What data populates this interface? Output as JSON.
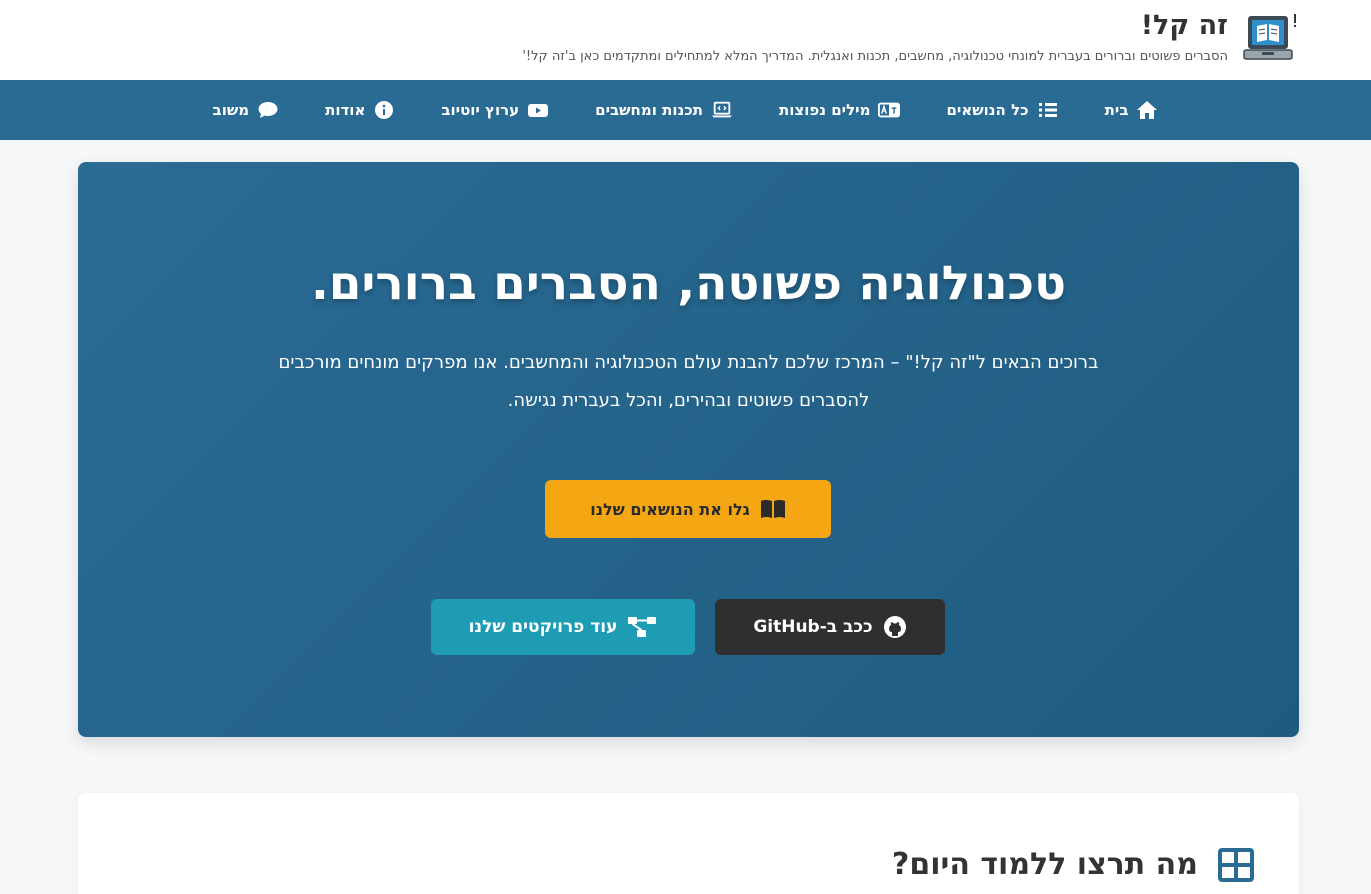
{
  "header": {
    "title": "זה קל!",
    "tagline": "הסברים פשוטים וברורים בעברית למונחי טכנולוגיה, מחשבים, תכנות ואנגלית. המדריך המלא למתחילים ומתקדמים כאן ב'זה קל!'"
  },
  "nav": {
    "items": [
      {
        "label": "בית",
        "icon": "home-icon"
      },
      {
        "label": "כל הנושאים",
        "icon": "list-icon"
      },
      {
        "label": "מילים נפוצות",
        "icon": "language-icon"
      },
      {
        "label": "תכנות ומחשבים",
        "icon": "laptop-code-icon"
      },
      {
        "label": "ערוץ יוטיוב",
        "icon": "youtube-icon"
      },
      {
        "label": "אודות",
        "icon": "info-icon"
      },
      {
        "label": "משוב",
        "icon": "comment-icon"
      }
    ]
  },
  "hero": {
    "title": "טכנולוגיה פשוטה, הסברים ברורים.",
    "text": "ברוכים הבאים ל\"זה קל!\" – המרכז שלכם להבנת עולם הטכנולוגיה והמחשבים. אנו מפרקים מונחים מורכבים להסברים פשוטים ובהירים, והכל בעברית נגישה.",
    "topics_button": "גלו את הנושאים שלנו",
    "github_button": "ככב ב-GitHub",
    "projects_button": "עוד פרויקטים שלנו"
  },
  "learn": {
    "title": "מה תרצו ללמוד היום?"
  },
  "colors": {
    "nav_bg": "#2a6b94",
    "hero_bg": "#23628a",
    "topics_btn": "#f5a613",
    "github_btn": "#2f2f2f",
    "projects_btn": "#1d9cb3"
  }
}
